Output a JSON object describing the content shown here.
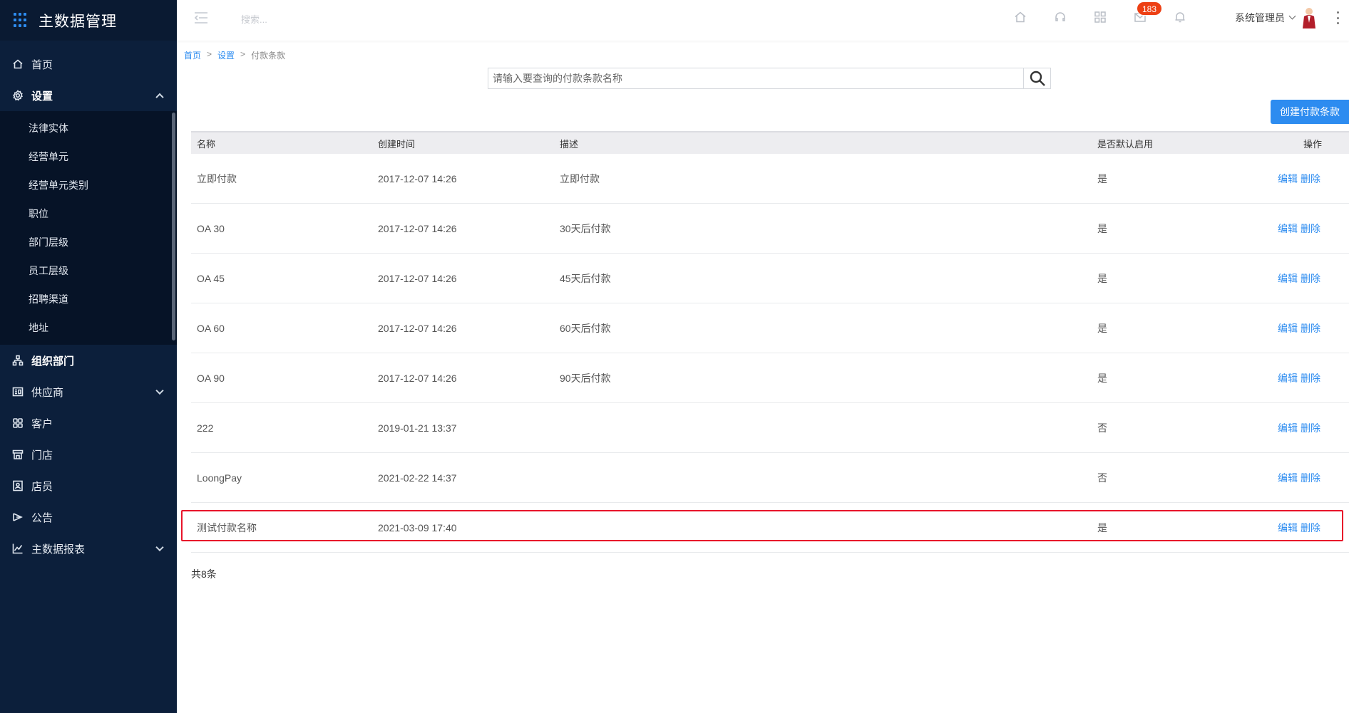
{
  "app": {
    "title": "主数据管理"
  },
  "sidebar": {
    "menu": [
      {
        "label": "首页",
        "icon": "home-icon"
      },
      {
        "label": "设置",
        "icon": "gear-icon",
        "expanded": true
      },
      {
        "label": "组织部门",
        "icon": "org-icon"
      },
      {
        "label": "供应商",
        "icon": "supplier-icon",
        "collapsible": true
      },
      {
        "label": "客户",
        "icon": "customer-icon"
      },
      {
        "label": "门店",
        "icon": "store-icon"
      },
      {
        "label": "店员",
        "icon": "clerk-icon"
      },
      {
        "label": "公告",
        "icon": "announcement-icon"
      },
      {
        "label": "主数据报表",
        "icon": "chart-icon",
        "collapsible": true
      }
    ],
    "settings_submenu": [
      "法律实体",
      "经营单元",
      "经营单元类别",
      "职位",
      "部门层级",
      "员工层级",
      "招聘渠道",
      "地址"
    ]
  },
  "header": {
    "search_placeholder": "搜索...",
    "notification_count": "183",
    "user_name": "系统管理员"
  },
  "breadcrumb": [
    "首页",
    "设置",
    "付款条款"
  ],
  "search": {
    "placeholder": "请输入要查询的付款条款名称"
  },
  "create_button": "创建付款条款",
  "table": {
    "columns": [
      "名称",
      "创建时间",
      "描述",
      "是否默认启用",
      "操作"
    ],
    "edit_label": "编辑",
    "delete_label": "删除",
    "rows": [
      {
        "name": "立即付款",
        "created": "2017-12-07 14:26",
        "desc": "立即付款",
        "default": "是"
      },
      {
        "name": "OA 30",
        "created": "2017-12-07 14:26",
        "desc": "30天后付款",
        "default": "是"
      },
      {
        "name": "OA 45",
        "created": "2017-12-07 14:26",
        "desc": "45天后付款",
        "default": "是"
      },
      {
        "name": "OA 60",
        "created": "2017-12-07 14:26",
        "desc": "60天后付款",
        "default": "是"
      },
      {
        "name": "OA 90",
        "created": "2017-12-07 14:26",
        "desc": "90天后付款",
        "default": "是"
      },
      {
        "name": "222",
        "created": "2019-01-21 13:37",
        "desc": "",
        "default": "否"
      },
      {
        "name": "LoongPay",
        "created": "2021-02-22 14:37",
        "desc": "",
        "default": "否"
      },
      {
        "name": "测试付款名称",
        "created": "2021-03-09 17:40",
        "desc": "",
        "default": "是"
      }
    ]
  },
  "total": "共8条",
  "colors": {
    "sidebar_bg": "#0c1f3b",
    "accent": "#2d8cf0",
    "badge": "#ed4014",
    "highlight": "#e8142a"
  }
}
